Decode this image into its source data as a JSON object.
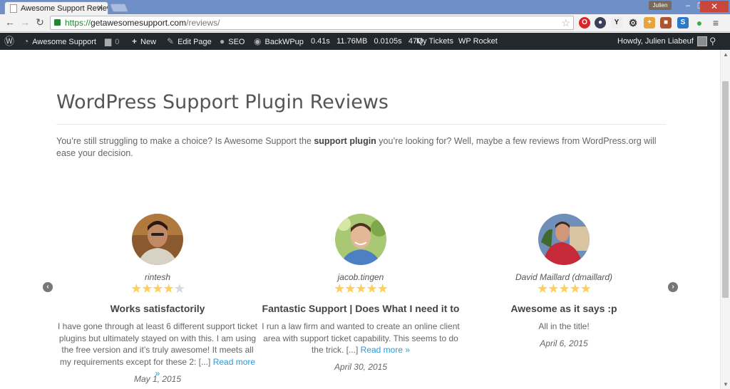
{
  "browser": {
    "tab_title": "Awesome Support Review",
    "user_badge": "Julien",
    "url_protocol": "https://",
    "url_host": "getawesomesupport.com",
    "url_path": "/reviews/"
  },
  "adminbar": {
    "site_name": "Awesome Support",
    "comments_count": "0",
    "new_label": "New",
    "edit_page_label": "Edit Page",
    "seo_label": "SEO",
    "backwpup_label": "BackWPup",
    "stats_time": "0.41s",
    "stats_memory": "11.76MB",
    "stats_query_time": "0.0105s",
    "stats_queries": "47Q",
    "my_tickets_label": "My Tickets",
    "wp_rocket_label": "WP Rocket",
    "howdy_label": "Howdy, Julien Liabeuf"
  },
  "page": {
    "title": "WordPress Support Plugin Reviews",
    "intro_before": "You’re still struggling to make a choice? Is Awesome Support the ",
    "intro_bold": "support plugin",
    "intro_after": " you’re looking for? Well, maybe a few reviews from WordPress.org will ease your decision."
  },
  "reviews": [
    {
      "author": "rintesh",
      "rating": 4,
      "title": "Works satisfactorily",
      "body": "I have gone through at least 6 different support ticket plugins but ultimately stayed on with this. I am using the free version and it’s truly awesome! It meets all my requirements except for these 2: [...] ",
      "read_more": "Read more »",
      "date": "May 1, 2015"
    },
    {
      "author": "jacob.tingen",
      "rating": 5,
      "title": "Fantastic Support | Does What I need it to",
      "body": "I run a law firm and wanted to create an online client area with support ticket capability. This seems to do the trick. [...] ",
      "read_more": "Read more »",
      "date": "April 30, 2015"
    },
    {
      "author": "David Maillard (dmaillard)",
      "rating": 5,
      "title": "Awesome as it says :p",
      "body": "All in the title!",
      "read_more": "",
      "date": "April 6, 2015"
    }
  ],
  "icons": {
    "prev": "chevron-left-icon",
    "next": "chevron-right-icon"
  },
  "colors": {
    "star_on": "#fecf5a",
    "star_off": "#d4d8e0",
    "link": "#2b9ad6",
    "adminbar_bg": "#23282d",
    "tabbar_bg": "#6f8fc8"
  }
}
